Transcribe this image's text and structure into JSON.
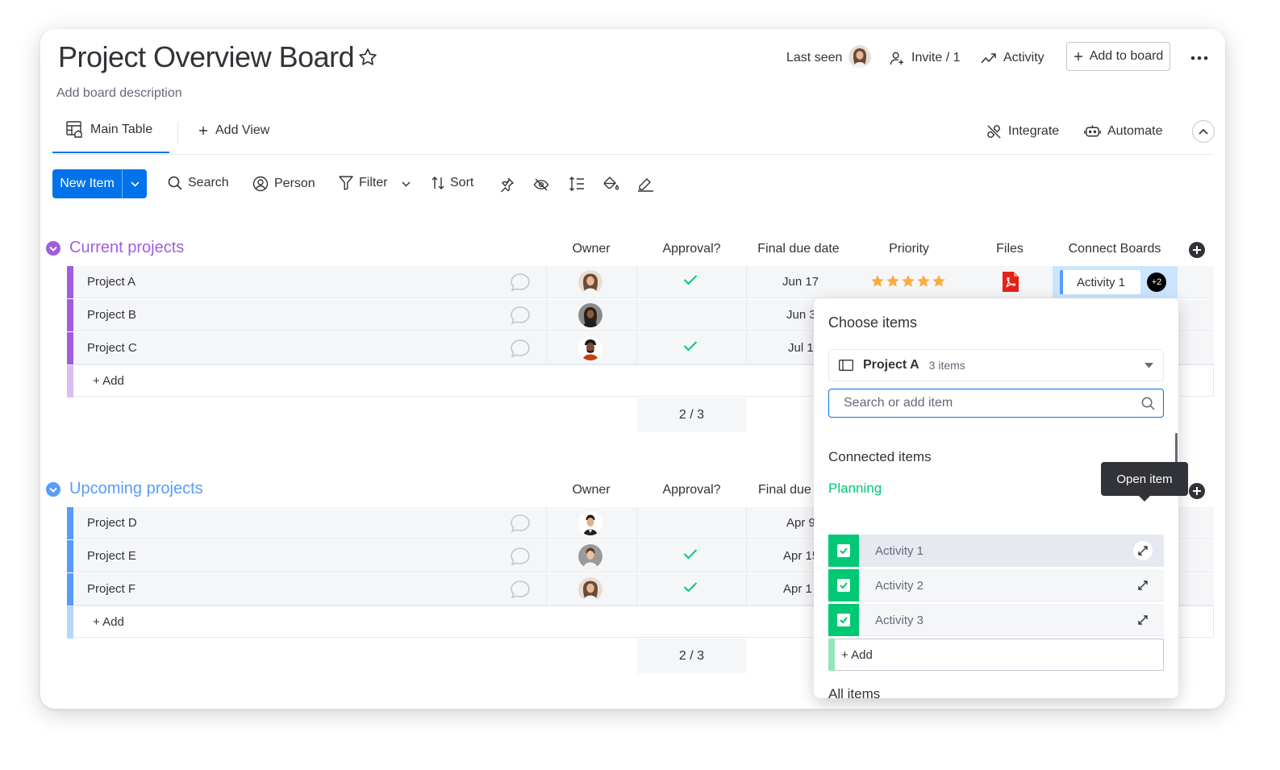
{
  "board": {
    "title": "Project Overview Board",
    "description": "Add board description"
  },
  "header": {
    "last_seen": "Last seen",
    "invite": "Invite / 1",
    "activity": "Activity",
    "add_to_board": "Add to board"
  },
  "tabs": {
    "main_table": "Main Table",
    "add_view": "Add View",
    "integrate": "Integrate",
    "automate": "Automate"
  },
  "toolbar": {
    "new_item": "New Item",
    "search": "Search",
    "person": "Person",
    "filter": "Filter",
    "sort": "Sort"
  },
  "columns": {
    "owner": "Owner",
    "approval": "Approval?",
    "final_due_date": "Final due date",
    "final_due_partial": "Final due",
    "priority": "Priority",
    "files": "Files",
    "connect_boards": "Connect Boards"
  },
  "groups": [
    {
      "title": "Current projects",
      "color": "#a25ddc",
      "light_color": "#dbbdf2",
      "rows": [
        {
          "name": "Project A",
          "approved": true,
          "due": "Jun 17",
          "priority": 5,
          "file": "pdf",
          "connect": "Activity 1",
          "connect_more": "+2"
        },
        {
          "name": "Project B",
          "approved": false,
          "due": "Jun 3"
        },
        {
          "name": "Project C",
          "approved": true,
          "due": "Jul 1"
        }
      ],
      "add_label": "+ Add",
      "summary": "2 / 3"
    },
    {
      "title": "Upcoming projects",
      "color": "#579bfc",
      "light_color": "#b7d4fd",
      "rows": [
        {
          "name": "Project D",
          "approved": false,
          "due": "Apr 9"
        },
        {
          "name": "Project E",
          "approved": true,
          "due": "Apr 15"
        },
        {
          "name": "Project F",
          "approved": true,
          "due": "Apr 1"
        }
      ],
      "add_label": "+ Add",
      "summary": "2 / 3"
    }
  ],
  "popover": {
    "title": "Choose items",
    "board_name": "Project A",
    "board_count": "3 items",
    "search_placeholder": "Search or add item",
    "connected_title": "Connected items",
    "group_name": "Planning",
    "items": [
      "Activity 1",
      "Activity 2",
      "Activity 3"
    ],
    "add_label": "+ Add",
    "all_items": "All items"
  },
  "tooltip": "Open item",
  "colors": {
    "primary": "#0073ea",
    "done": "#00c875",
    "star": "#fdab3d",
    "pdf": "#e2231a"
  }
}
